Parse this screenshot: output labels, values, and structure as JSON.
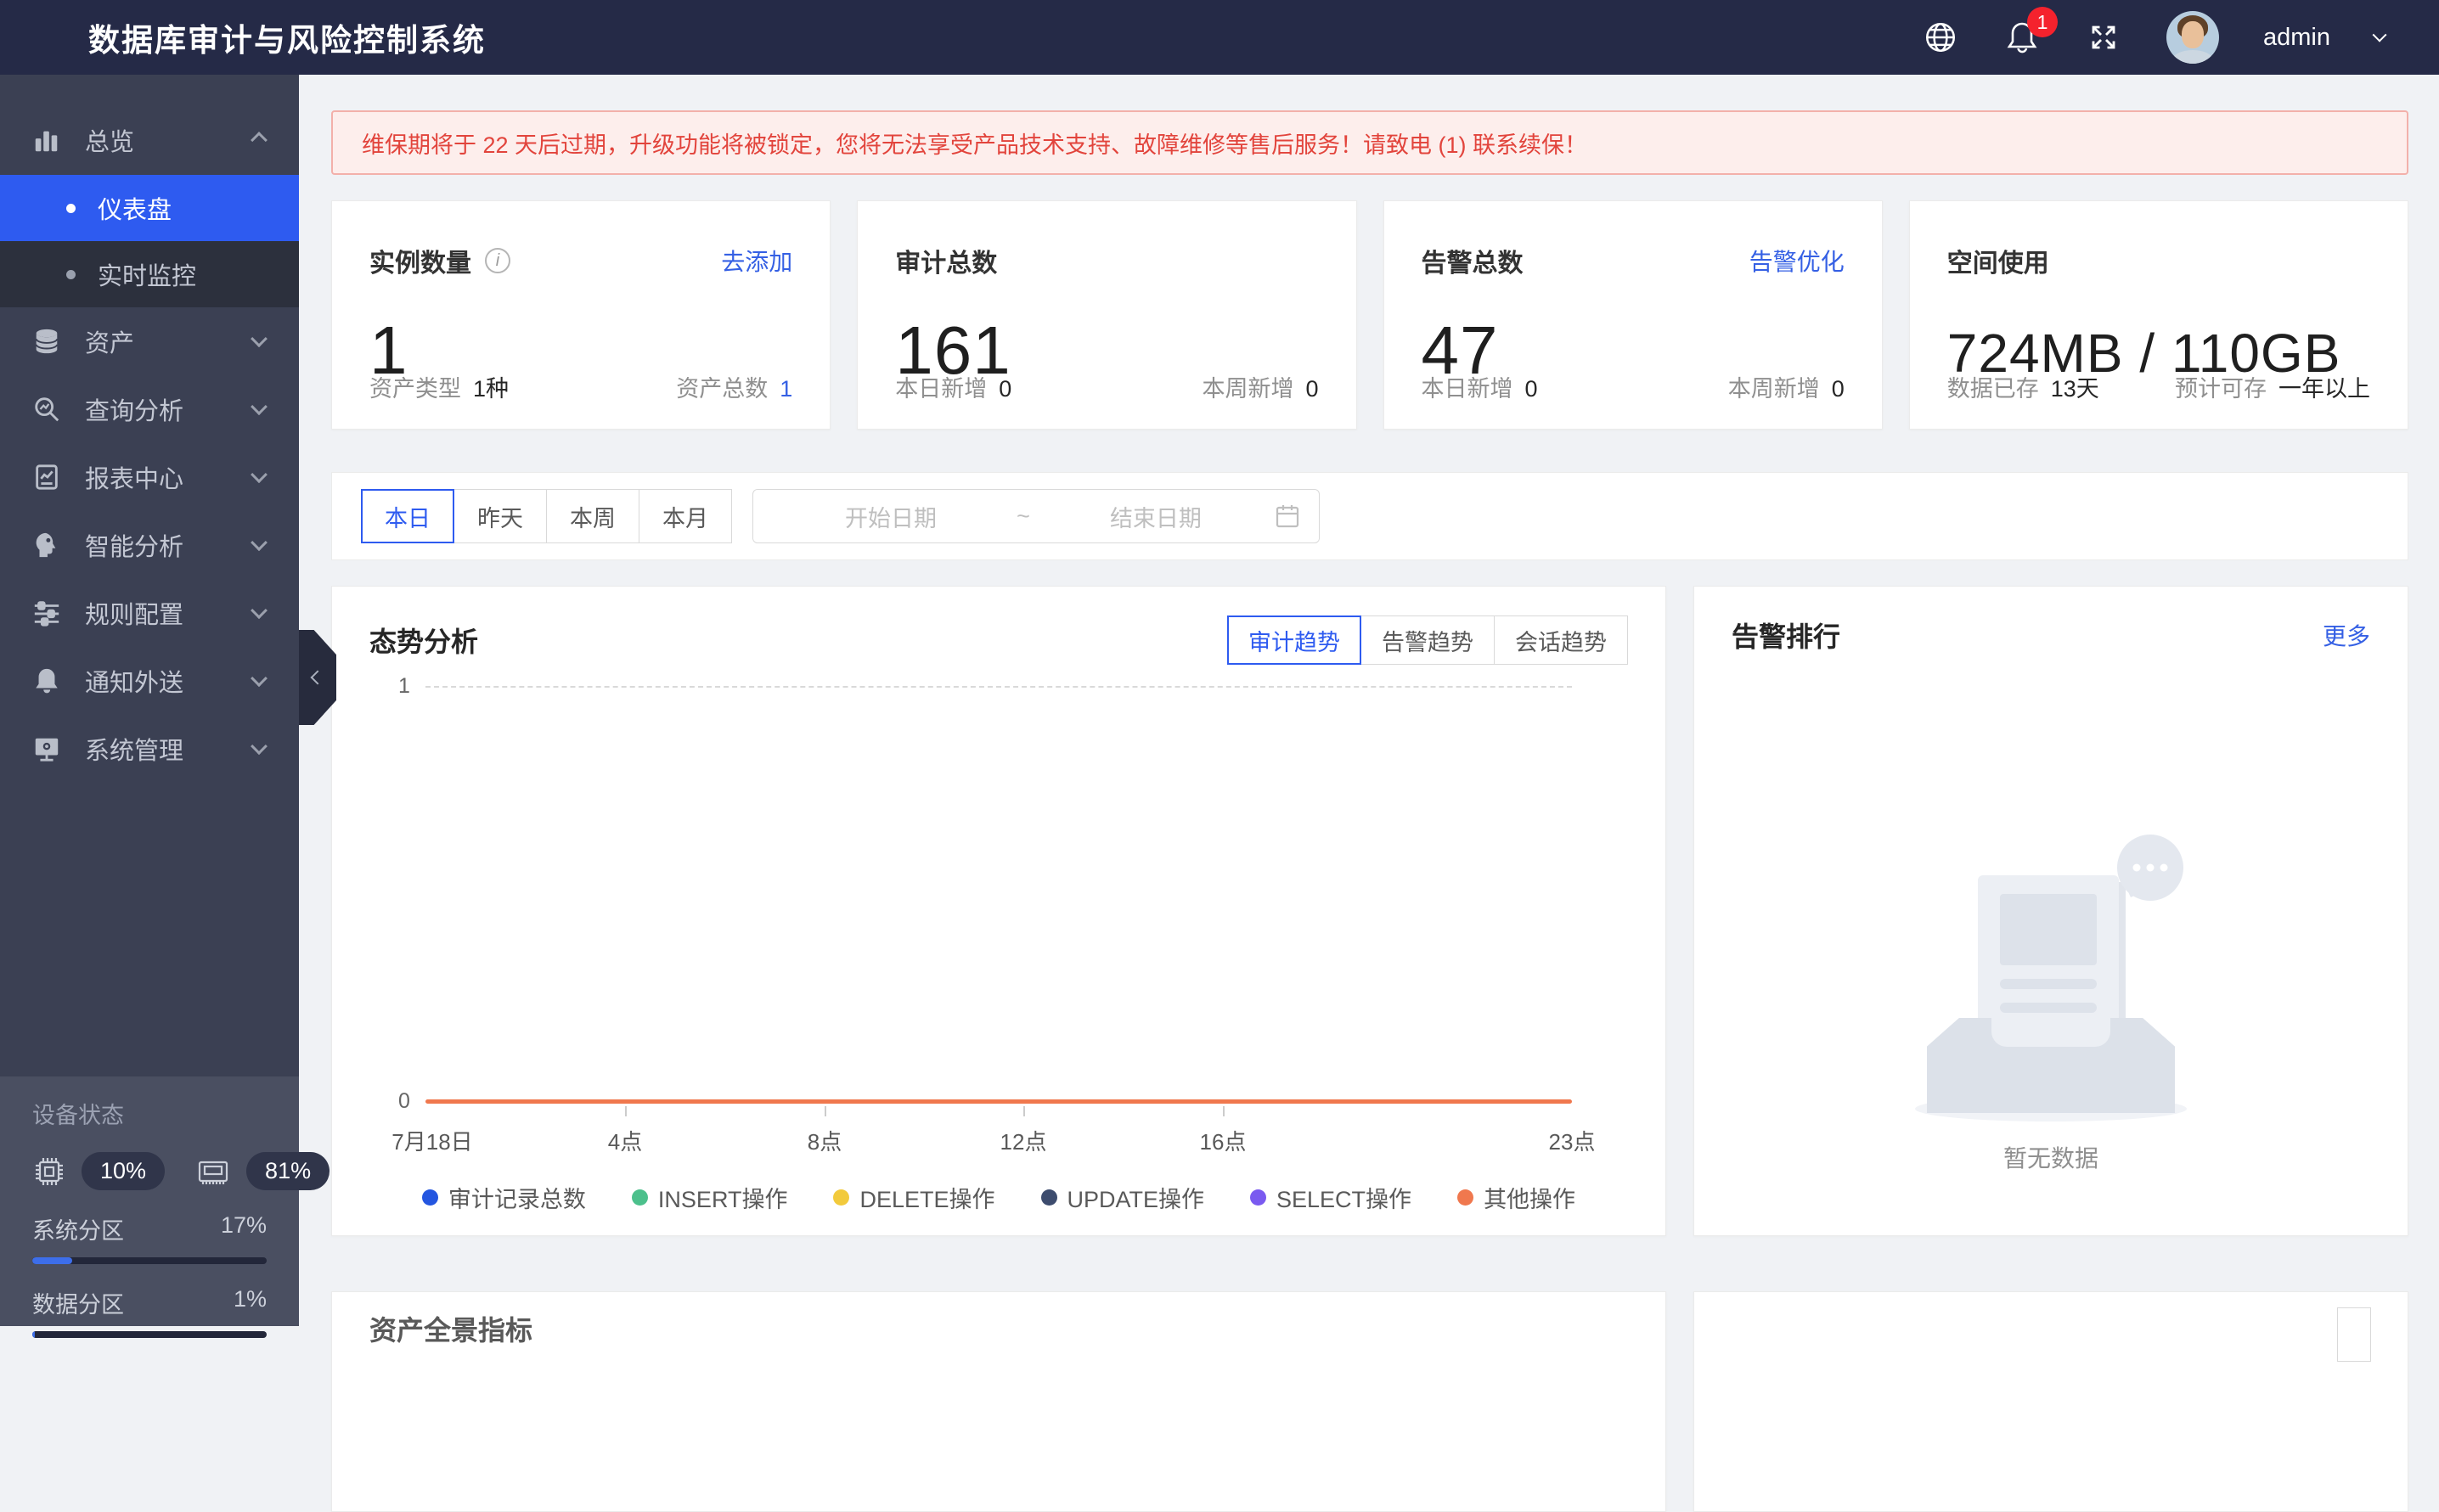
{
  "app": {
    "title": "数据库审计与风险控制系统"
  },
  "header": {
    "notification_badge": "1",
    "username": "admin"
  },
  "sidebar": {
    "groups": [
      {
        "label": "总览",
        "expanded": true,
        "children": [
          {
            "label": "仪表盘",
            "active": true
          },
          {
            "label": "实时监控",
            "active": false
          }
        ]
      },
      {
        "label": "资产"
      },
      {
        "label": "查询分析"
      },
      {
        "label": "报表中心"
      },
      {
        "label": "智能分析"
      },
      {
        "label": "规则配置"
      },
      {
        "label": "通知外送"
      },
      {
        "label": "系统管理"
      }
    ],
    "device_status": {
      "title": "设备状态",
      "cpu_usage": "10%",
      "memory_usage": "81%",
      "partitions": [
        {
          "label": "系统分区",
          "value": "17%"
        },
        {
          "label": "数据分区",
          "value": "1%"
        }
      ]
    }
  },
  "banner": {
    "text": "维保期将于 22 天后过期，升级功能将被锁定，您将无法享受产品技术支持、故障维修等售后服务！请致电 (1) 联系续保！"
  },
  "stats": {
    "cards": [
      {
        "title": "实例数量",
        "link": "去添加",
        "value": "1",
        "footer_left_label": "资产类型",
        "footer_left_value": "1种",
        "footer_right_label": "资产总数",
        "footer_right_value": "1"
      },
      {
        "title": "审计总数",
        "value": "161",
        "footer_left_label": "本日新增",
        "footer_left_value": "0",
        "footer_right_label": "本周新增",
        "footer_right_value": "0"
      },
      {
        "title": "告警总数",
        "link": "告警优化",
        "value": "47",
        "footer_left_label": "本日新增",
        "footer_left_value": "0",
        "footer_right_label": "本周新增",
        "footer_right_value": "0"
      },
      {
        "title": "空间使用",
        "value": "724MB / 110GB",
        "footer_left_label": "数据已存",
        "footer_left_value": "13天",
        "footer_right_label": "预计可存",
        "footer_right_value": "一年以上"
      }
    ]
  },
  "filters": {
    "quick_buttons": [
      "本日",
      "昨天",
      "本周",
      "本月"
    ],
    "active_button": "本日",
    "start_placeholder": "开始日期",
    "separator": "~",
    "end_placeholder": "结束日期"
  },
  "trend_section": {
    "title": "态势分析",
    "tabs": [
      "审计趋势",
      "告警趋势",
      "会话趋势"
    ],
    "active_tab": "审计趋势"
  },
  "chart_data": {
    "type": "line",
    "title": "审计趋势（本日）",
    "x": [
      0,
      4,
      8,
      12,
      16,
      23
    ],
    "x_tick_labels": [
      "7月18日",
      "4点",
      "8点",
      "12点",
      "16点",
      "23点"
    ],
    "x_range_hours": [
      0,
      23
    ],
    "ylim": [
      0,
      1
    ],
    "y_tick_labels": [
      "0",
      "1"
    ],
    "grid": "horizontal dashed gridline at y=1",
    "legend_position": "bottom",
    "series": [
      {
        "name": "审计记录总数",
        "color": "#2456e0",
        "values": [
          0,
          0,
          0,
          0,
          0,
          0
        ]
      },
      {
        "name": "INSERT操作",
        "color": "#4cc08c",
        "values": [
          0,
          0,
          0,
          0,
          0,
          0
        ]
      },
      {
        "name": "DELETE操作",
        "color": "#f2ca3c",
        "values": [
          0,
          0,
          0,
          0,
          0,
          0
        ]
      },
      {
        "name": "UPDATE操作",
        "color": "#3d4c6e",
        "values": [
          0,
          0,
          0,
          0,
          0,
          0
        ]
      },
      {
        "name": "SELECT操作",
        "color": "#7a5af0",
        "values": [
          0,
          0,
          0,
          0,
          0,
          0
        ]
      },
      {
        "name": "其他操作",
        "color": "#f0784e",
        "values": [
          0,
          0,
          0,
          0,
          0,
          0
        ]
      }
    ]
  },
  "alarm_rank": {
    "title": "告警排行",
    "link": "更多",
    "empty_text": "暂无数据"
  },
  "bottom_section": {
    "title": "资产全景指标"
  },
  "colors": {
    "accent_blue": "#2e5bf0",
    "link_blue": "#3560e4",
    "header_bg": "#252a47",
    "sidebar_bg": "#3b4053",
    "sidebar_submenu_bg": "#2c303d",
    "device_panel_bg": "#4a4f61",
    "banner_bg": "#fdeeec",
    "banner_text": "#e2443c",
    "badge_red": "#f5222d",
    "page_bg": "#f0f2f5"
  }
}
